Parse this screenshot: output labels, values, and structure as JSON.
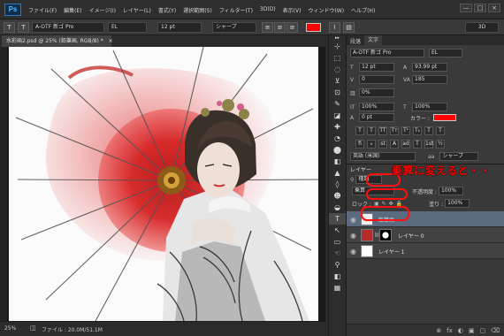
{
  "app": {
    "logo": "Ps",
    "window_controls": [
      "—",
      "□",
      "×"
    ]
  },
  "menubar": {
    "items": [
      "ファイル(F)",
      "編集(E)",
      "イメージ(I)",
      "レイヤー(L)",
      "書式(Y)",
      "選択範囲(S)",
      "フィルター(T)",
      "3D(D)",
      "表示(V)",
      "ウィンドウ(W)",
      "ヘルプ(H)"
    ]
  },
  "options_bar": {
    "font_family": "A-OTF 新ゴ Pro",
    "font_style": "EL",
    "font_size": "12 pt",
    "aa": "シャープ",
    "color": "#ff0000",
    "mode": "3D",
    "orient": "T",
    "align": [
      "≡",
      "≡",
      "≡"
    ]
  },
  "document": {
    "tab": "水彩画2.psd @ 25% (鉛筆画, RGB/8) *",
    "close": "×"
  },
  "status": {
    "zoom": "25%",
    "file": "ファイル : 20.0M/51.1M"
  },
  "tools": {
    "icons": [
      "⊹",
      "⬚",
      "◌",
      "⊻",
      "⊡",
      "✎",
      "◪",
      "✚",
      "◔",
      "⬤",
      "◧",
      "▲",
      "◊",
      "☻",
      "◒",
      "T",
      "↖",
      "▭",
      "☜",
      "⚲",
      "◧",
      "▦"
    ]
  },
  "character_panel": {
    "tabs": [
      "段落",
      "文字"
    ],
    "active_tab": "文字",
    "font_family": "A-OTF 新ゴ Pro",
    "font_style": "EL",
    "size": "12 pt",
    "leading": "93.99 pt",
    "kerning": "0",
    "tracking": "185",
    "tsume": "0%",
    "vscale": "100%",
    "hscale": "100%",
    "baseline": "0 pt",
    "color_label": "カラー :",
    "color": "#ff0000",
    "style_buttons": [
      "T",
      "T",
      "TT",
      "Tт",
      "T¹",
      "T₁",
      "T",
      "T"
    ],
    "otype_buttons": [
      "fi",
      "ℴ",
      "st",
      "A",
      "ad",
      "T",
      "1st",
      "½"
    ],
    "language": "英語 (米国)",
    "aa": "シャープ"
  },
  "layers_panel": {
    "title": "レイヤー",
    "filter": "種類",
    "blend_mode": "乗算",
    "opacity_label": "不透明度 :",
    "opacity": "100%",
    "lock_label": "ロック :",
    "fill_label": "塗り :",
    "fill": "100%",
    "layers": [
      {
        "name": "鉛筆画",
        "selected": true
      },
      {
        "name": "レイヤー 0",
        "selected": false
      },
      {
        "name": "レイヤー 1",
        "selected": false
      }
    ],
    "bottom_icons": [
      "⊗",
      "fx",
      "◐",
      "▣",
      "▢",
      "⌫"
    ]
  },
  "annotation": {
    "text": "乗算に変えると・・",
    "color": "#ff0000"
  }
}
